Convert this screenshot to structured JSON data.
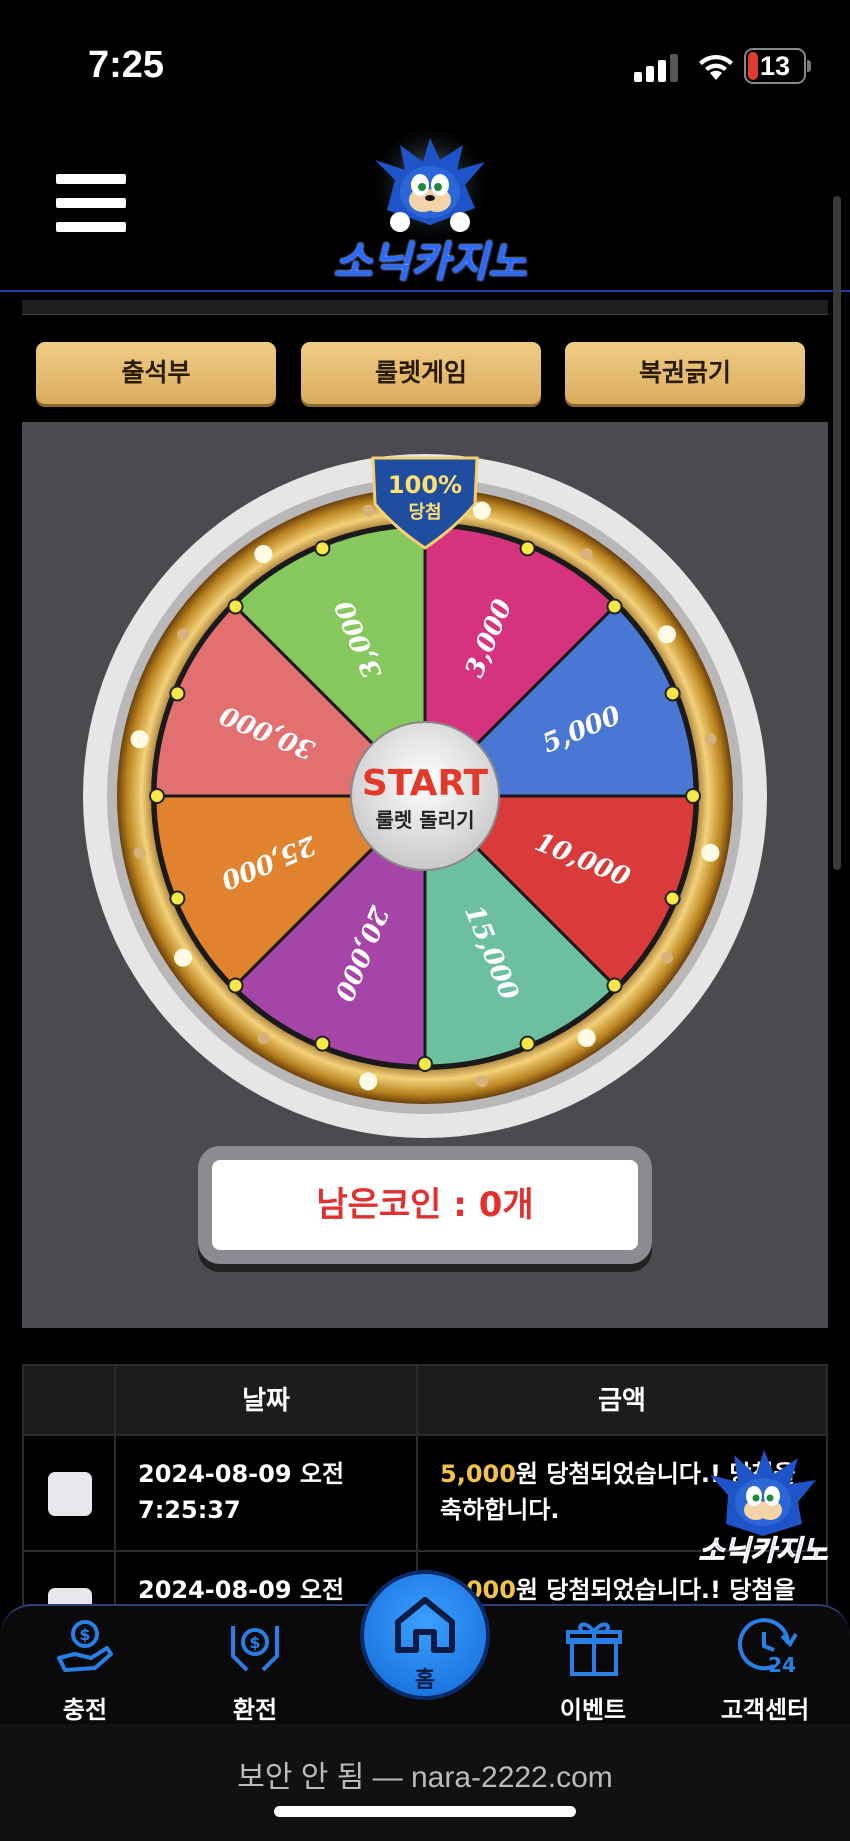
{
  "status_bar": {
    "time": "7:25",
    "battery": "13"
  },
  "header": {
    "logo_text": "소닉카지노"
  },
  "tabs": [
    {
      "label": "출석부"
    },
    {
      "label": "룰렛게임"
    },
    {
      "label": "복권긁기"
    }
  ],
  "roulette": {
    "badge_top": "100%",
    "badge_bottom": "당첨",
    "start_label": "START",
    "start_sub": "룰렛 돌리기",
    "segments": [
      {
        "value": "3,000",
        "color": "#d6337f"
      },
      {
        "value": "5,000",
        "color": "#4a77d4"
      },
      {
        "value": "10,000",
        "color": "#d93a3a"
      },
      {
        "value": "15,000",
        "color": "#6cc0a0"
      },
      {
        "value": "20,000",
        "color": "#a545a8"
      },
      {
        "value": "25,000",
        "color": "#e0822e"
      },
      {
        "value": "30,000",
        "color": "#e27070"
      },
      {
        "value": "3,000",
        "color": "#86c75e"
      }
    ]
  },
  "coins": {
    "label": "남은코인 : 0개"
  },
  "history": {
    "headers": [
      "",
      "날짜",
      "금액"
    ],
    "rows": [
      {
        "date": "2024-08-09 오전 7:25:37",
        "amount": "5,000",
        "msg1": "원 당첨되었습니다.! 당첨을",
        "msg2": "축하합니다."
      },
      {
        "date": "2024-08-09 오전",
        "amount": "3,000",
        "msg1": "원 당첨되었습니다.! 당첨을",
        "msg2": ""
      }
    ]
  },
  "nav": {
    "items": [
      {
        "label": "충전",
        "icon": "hand-dollar-icon"
      },
      {
        "label": "환전",
        "icon": "hands-dollar-icon"
      },
      {
        "label": "홈",
        "icon": "home-icon"
      },
      {
        "label": "이벤트",
        "icon": "gift-icon"
      },
      {
        "label": "고객센터",
        "icon": "support-24-icon"
      }
    ]
  },
  "url_bar": {
    "text": "보안 안 됨 — nara-2222.com"
  },
  "colors": {
    "accent_gold": "#e8c07a",
    "nav_blue": "#2a7fe6",
    "highlight_yellow": "#f2c24a",
    "coin_red": "#e03030"
  }
}
